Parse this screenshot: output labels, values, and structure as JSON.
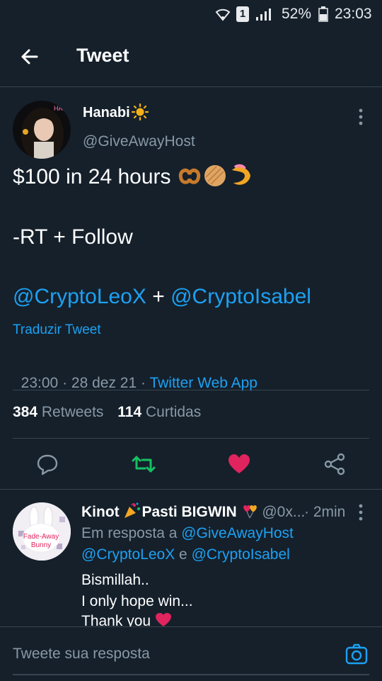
{
  "status_bar": {
    "battery": "52%",
    "time": "23:03",
    "sim": "1"
  },
  "header": {
    "title": "Tweet"
  },
  "tweet": {
    "author_name": "Hanabi",
    "author_handle": "@GiveAwayHost",
    "line1": "$100 in 24 hours",
    "line2": "-RT + Follow",
    "mention1": "@CryptoLeoX",
    "plus": " + ",
    "mention2": "@CryptoIsabel",
    "translate": "Traduzir Tweet",
    "time": "23:00",
    "sep": " · ",
    "date": "28 dez 21",
    "source": "Twitter Web App",
    "retweets_count": "384",
    "retweets_label": "Retweets",
    "likes_count": "114",
    "likes_label": "Curtidas"
  },
  "reply": {
    "name_part1": "Kinot ",
    "name_part2": "Pasti BIGWIN",
    "handle": "@0x...",
    "time": "· 2min",
    "in_reply_prefix": "Em resposta a ",
    "reply_to1": "@GiveAwayHost",
    "reply_to2": "@CryptoLeoX",
    "and": " e ",
    "reply_to3": "@CryptoIsabel",
    "text_line1": "Bismillah..",
    "text_line2": "I only hope win...",
    "text_line3": "Thank you",
    "avatar_text1": "Fade-Away",
    "avatar_text2": "Bunny"
  },
  "compose": {
    "placeholder": "Tweete sua resposta"
  },
  "colors": {
    "background": "#15202b",
    "accent": "#1da1f2",
    "muted": "#8899a6",
    "retweet": "#17bf63",
    "like": "#e0245e"
  }
}
